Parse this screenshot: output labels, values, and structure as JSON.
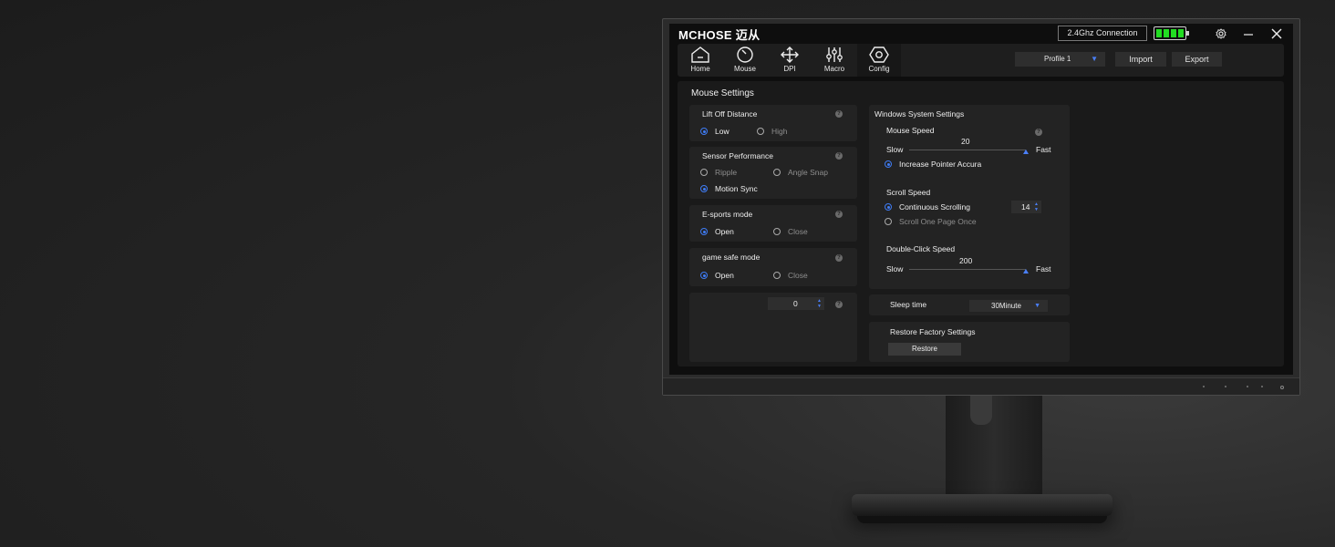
{
  "app": {
    "logo": "MCHOSE 迈从",
    "connection": "2.4Ghz Connection",
    "battery_level": 1.0
  },
  "nav": {
    "home": "Home",
    "mouse": "Mouse",
    "dpi": "DPI",
    "macro": "Macro",
    "config": "Config",
    "active": "config"
  },
  "toolbar": {
    "profile": "Profile  1",
    "import": "Import",
    "export": "Export"
  },
  "page_title": "Mouse Settings",
  "lift_off": {
    "title": "Lift Off Distance",
    "options": [
      "Low",
      "High"
    ],
    "selected": "Low"
  },
  "sensor": {
    "title": "Sensor Performance",
    "options": [
      "Ripple",
      "Angle Snap",
      "Motion Sync"
    ],
    "selected": "Motion Sync"
  },
  "esports": {
    "title": "E-sports mode",
    "options": [
      "Open",
      "Close"
    ],
    "selected": "Open"
  },
  "game_safe": {
    "title": "game safe mode",
    "options": [
      "Open",
      "Close"
    ],
    "selected": "Open"
  },
  "misc": {
    "value": "0"
  },
  "windows": {
    "title": "Windows System Settings",
    "mouse_speed": {
      "label": "Mouse Speed",
      "value": "20",
      "slow": "Slow",
      "fast": "Fast",
      "position": 1.0
    },
    "pointer_accuracy": "Increase Pointer Accura",
    "scroll_speed": {
      "label": "Scroll Speed",
      "continuous": "Continuous Scrolling",
      "one_page": "Scroll One Page Once",
      "value": "14"
    },
    "double_click": {
      "label": "Double-Click Speed",
      "value": "200",
      "slow": "Slow",
      "fast": "Fast",
      "position": 1.0
    }
  },
  "sleep": {
    "label": "Sleep time",
    "value": "30Minute"
  },
  "restore": {
    "title": "Restore Factory Settings",
    "button": "Restore"
  }
}
